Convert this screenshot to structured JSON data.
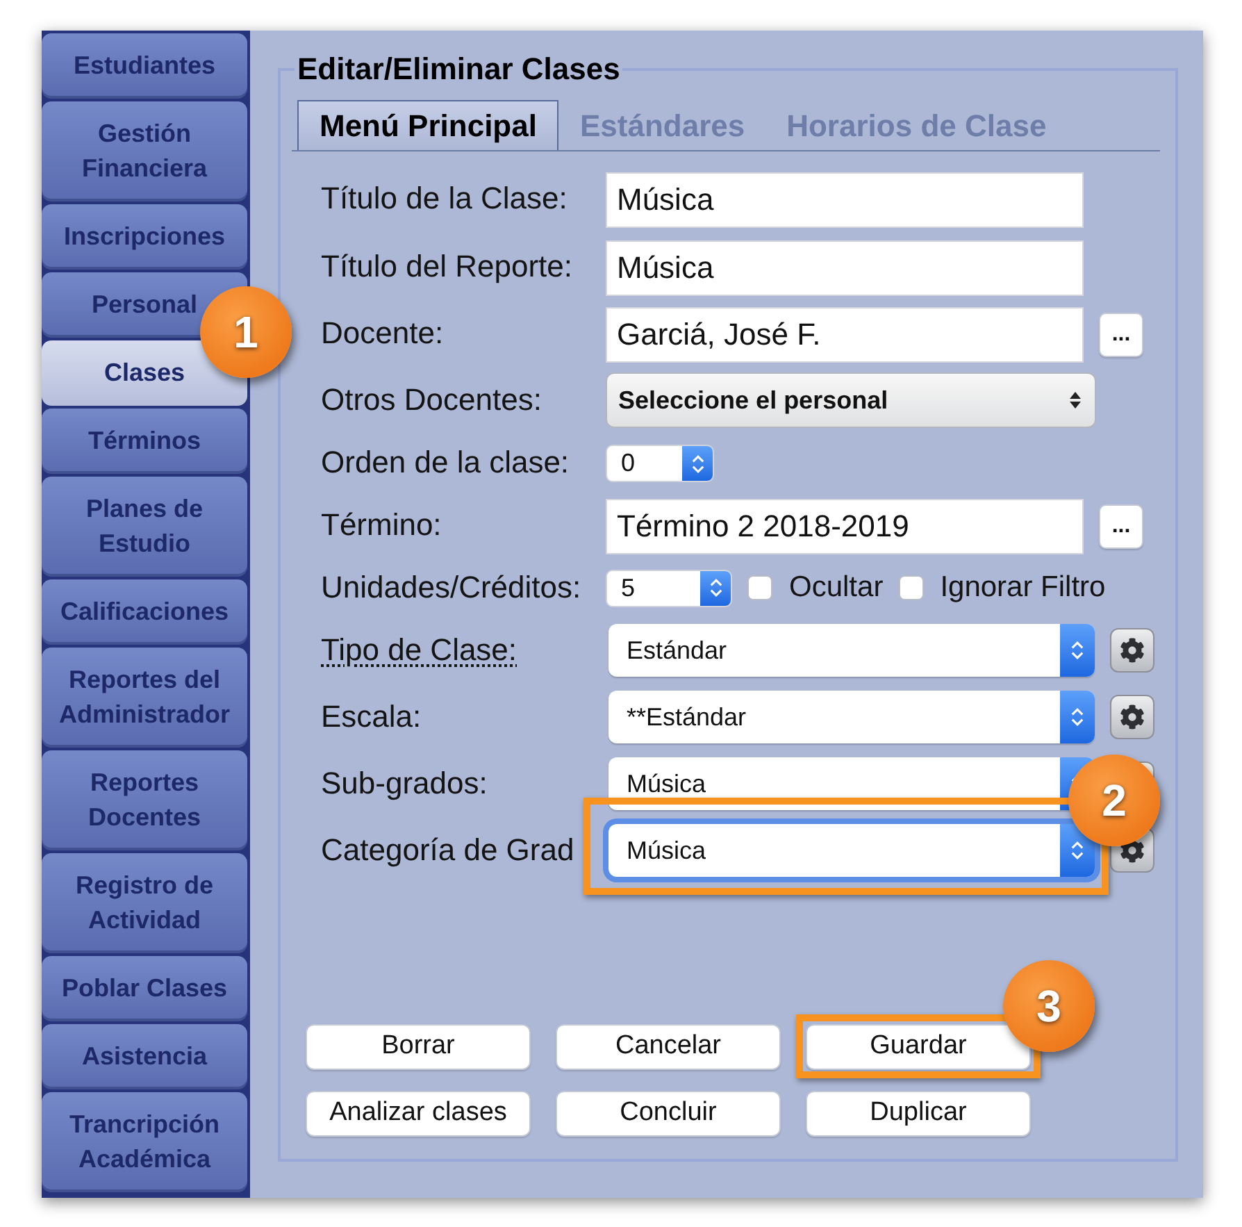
{
  "sidebar": {
    "items": [
      {
        "label": "Estudiantes",
        "selected": false
      },
      {
        "label": "Gestión Financiera",
        "selected": false
      },
      {
        "label": "Inscripciones",
        "selected": false
      },
      {
        "label": "Personal",
        "selected": false
      },
      {
        "label": "Clases",
        "selected": true,
        "callout": "1"
      },
      {
        "label": "Términos",
        "selected": false
      },
      {
        "label": "Planes de Estudio",
        "selected": false
      },
      {
        "label": "Calificaciones",
        "selected": false
      },
      {
        "label": "Reportes del Administrador",
        "selected": false
      },
      {
        "label": "Reportes Docentes",
        "selected": false
      },
      {
        "label": "Registro de Actividad",
        "selected": false
      },
      {
        "label": "Poblar Clases",
        "selected": false
      },
      {
        "label": "Asistencia",
        "selected": false
      },
      {
        "label": "Trancripción Académica",
        "selected": false
      }
    ]
  },
  "panel": {
    "title": "Editar/Eliminar Clases",
    "tabs": [
      {
        "label": "Menú Principal",
        "selected": true
      },
      {
        "label": "Estándares",
        "selected": false
      },
      {
        "label": "Horarios de Clase",
        "selected": false
      }
    ],
    "fields": [
      {
        "kind": "text",
        "label": "Título de la Clase:",
        "value": "Música",
        "label_link": false,
        "focused": false,
        "highlighted": false
      },
      {
        "kind": "text",
        "label": "Título del Reporte:",
        "value": "Música",
        "label_link": false,
        "focused": false,
        "highlighted": false
      },
      {
        "kind": "lookup",
        "label": "Docente:",
        "value": "Garciá, José F.",
        "button": "...",
        "label_link": false,
        "focused": false,
        "highlighted": false
      },
      {
        "kind": "menu",
        "label": "Otros Docentes:",
        "value": "Seleccione el personal",
        "label_link": false,
        "focused": false,
        "highlighted": false
      },
      {
        "kind": "number",
        "label": "Orden de la clase:",
        "value": "0",
        "label_link": false,
        "focused": false,
        "highlighted": false
      },
      {
        "kind": "lookup",
        "label": "Término:",
        "value": "Término 2 2018-2019",
        "button": "...",
        "label_link": false,
        "focused": false,
        "highlighted": false
      },
      {
        "kind": "number_checks",
        "label": "Unidades/Créditos:",
        "value": "5",
        "checks": [
          {
            "label": "Ocultar",
            "checked": false
          },
          {
            "label": "Ignorar Filtro",
            "checked": false
          }
        ],
        "label_link": false,
        "focused": false,
        "highlighted": false
      },
      {
        "kind": "select",
        "label": "Tipo de Clase:",
        "value": "Estándar",
        "label_link": true,
        "focused": false,
        "highlighted": false
      },
      {
        "kind": "select",
        "label": "Escala:",
        "value": "**Estándar",
        "label_link": false,
        "focused": false,
        "highlighted": false
      },
      {
        "kind": "select",
        "label": "Sub-grados:",
        "value": "Música",
        "label_link": false,
        "focused": false,
        "highlighted": false
      },
      {
        "kind": "select",
        "label": "Categoría de Grad",
        "value": "Música",
        "label_link": false,
        "focused": true,
        "highlighted": true,
        "callout": "2"
      }
    ],
    "buttons": [
      {
        "label": "Borrar",
        "highlighted": false
      },
      {
        "label": "Cancelar",
        "highlighted": false
      },
      {
        "label": "Guardar",
        "highlighted": true,
        "callout": "3"
      },
      {
        "label": "Analizar clases",
        "highlighted": false
      },
      {
        "label": "Concluir",
        "highlighted": false
      },
      {
        "label": "Duplicar",
        "highlighted": false
      }
    ]
  }
}
